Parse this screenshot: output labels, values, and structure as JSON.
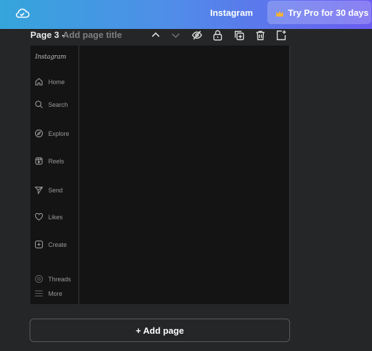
{
  "header": {
    "doc_title": "Instagram",
    "pro_label": "Try Pro for 30 days"
  },
  "page": {
    "number_label": "Page 3 -",
    "title_placeholder": "Add page title"
  },
  "canvas": {
    "logo_text": "Instagram",
    "nav_items": [
      {
        "label": "Home",
        "icon": "home-icon"
      },
      {
        "label": "Search",
        "icon": "search-icon"
      },
      {
        "label": "Explore",
        "icon": "compass-icon"
      },
      {
        "label": "Reels",
        "icon": "reels-icon"
      },
      {
        "label": "Send",
        "icon": "send-icon"
      },
      {
        "label": "Likes",
        "icon": "heart-icon"
      },
      {
        "label": "Create",
        "icon": "plus-square-icon"
      },
      {
        "label": "Threads",
        "icon": "threads-icon"
      },
      {
        "label": "More",
        "icon": "menu-icon"
      }
    ]
  },
  "footer": {
    "add_page_label": "+ Add page"
  },
  "colors": {
    "gradient_start": "#35a5dc",
    "gradient_end": "#6a5cf0",
    "background": "#252627",
    "canvas": "#141414",
    "crown": "#f5b335"
  }
}
